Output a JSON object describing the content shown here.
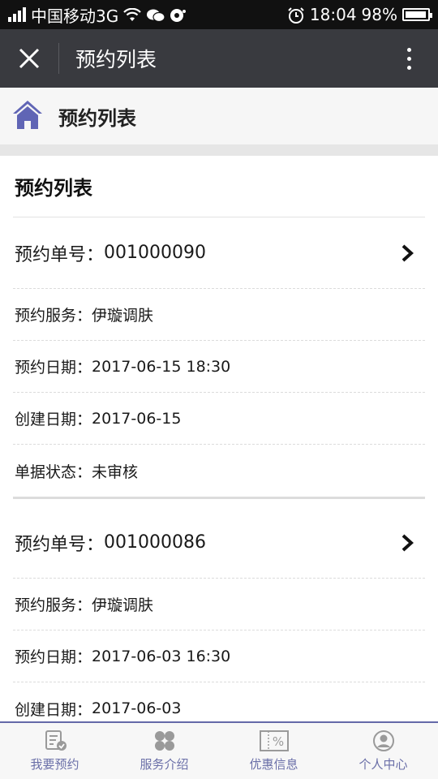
{
  "status_bar": {
    "carrier": "中国移动3G",
    "time": "18:04",
    "battery": "98%",
    "battery_level": 0.98
  },
  "title_bar": {
    "title": "预约列表"
  },
  "page_header": {
    "title": "预约列表",
    "icon": "home-icon"
  },
  "list": {
    "section_title": "预约列表",
    "orders": [
      {
        "number_label": "预约单号：",
        "number": "001000090",
        "service_label": "预约服务：",
        "service": "伊璇调肤",
        "date_label": "预约日期：",
        "date": "2017-06-15 18:30",
        "created_label": "创建日期：",
        "created": "2017-06-15",
        "status_label": "单据状态：",
        "status": "未审核"
      },
      {
        "number_label": "预约单号：",
        "number": "001000086",
        "service_label": "预约服务：",
        "service": "伊璇调肤",
        "date_label": "预约日期：",
        "date": "2017-06-03 16:30",
        "created_label": "创建日期：",
        "created": "2017-06-03"
      }
    ]
  },
  "tab_bar": {
    "tabs": [
      {
        "label": "我要预约",
        "icon": "booking-icon"
      },
      {
        "label": "服务介绍",
        "icon": "grid-icon"
      },
      {
        "label": "优惠信息",
        "icon": "discount-icon"
      },
      {
        "label": "个人中心",
        "icon": "user-icon"
      }
    ]
  },
  "colors": {
    "accent": "#6a6fa8",
    "titlebar": "#393a3f",
    "statusbar": "#111111"
  }
}
